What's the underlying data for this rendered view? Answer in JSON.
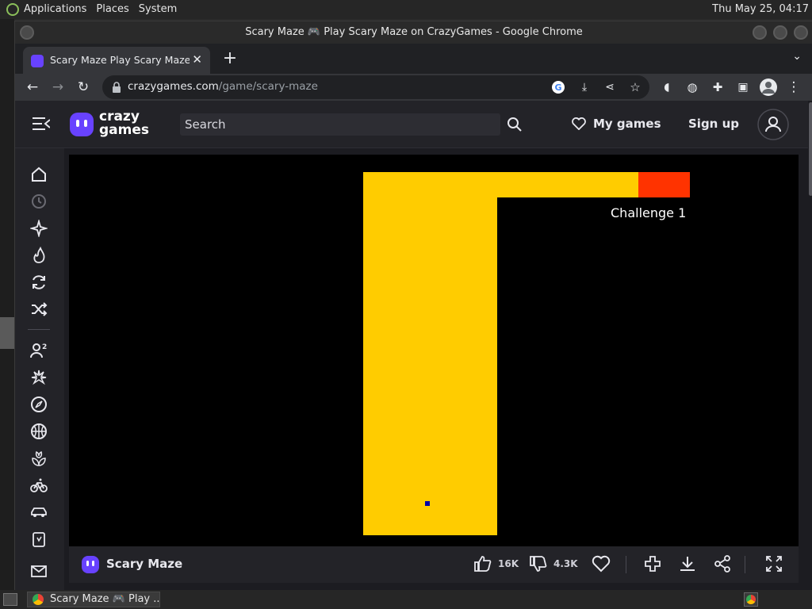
{
  "os_panel": {
    "menus": [
      "Applications",
      "Places",
      "System"
    ],
    "clock": "Thu May 25, 04:17"
  },
  "browser": {
    "window_title": "Scary Maze 🎮 Play Scary Maze on CrazyGames - Google Chrome",
    "tab_title": "Scary Maze   Play Scary Maze",
    "new_tab_symbol": "+",
    "url_host": "crazygames.com",
    "url_path": "/game/scary-maze"
  },
  "site": {
    "logo_line1": "crazy",
    "logo_line2": "games",
    "search_placeholder": "Search",
    "my_games_label": "My games",
    "sign_up_label": "Sign up",
    "sidebar_icons": [
      "home-icon",
      "recent-icon",
      "new-icon",
      "trending-icon",
      "updated-icon",
      "random-icon",
      "two-player-icon",
      "action-icon",
      "adventure-icon",
      "basketball-icon",
      "casual-icon",
      "bike-icon",
      "car-icon",
      "card-icon",
      "mail-icon"
    ],
    "accent_color": "#6842ff"
  },
  "game": {
    "label": "Challenge 1",
    "path_color": "#ffcc00",
    "goal_color": "#ff3300",
    "player_color": "#0000aa"
  },
  "game_bar": {
    "title": "Scary Maze",
    "likes": "16K",
    "dislikes": "4.3K"
  },
  "taskbar": {
    "item_label": "Scary Maze 🎮 Play ..."
  }
}
